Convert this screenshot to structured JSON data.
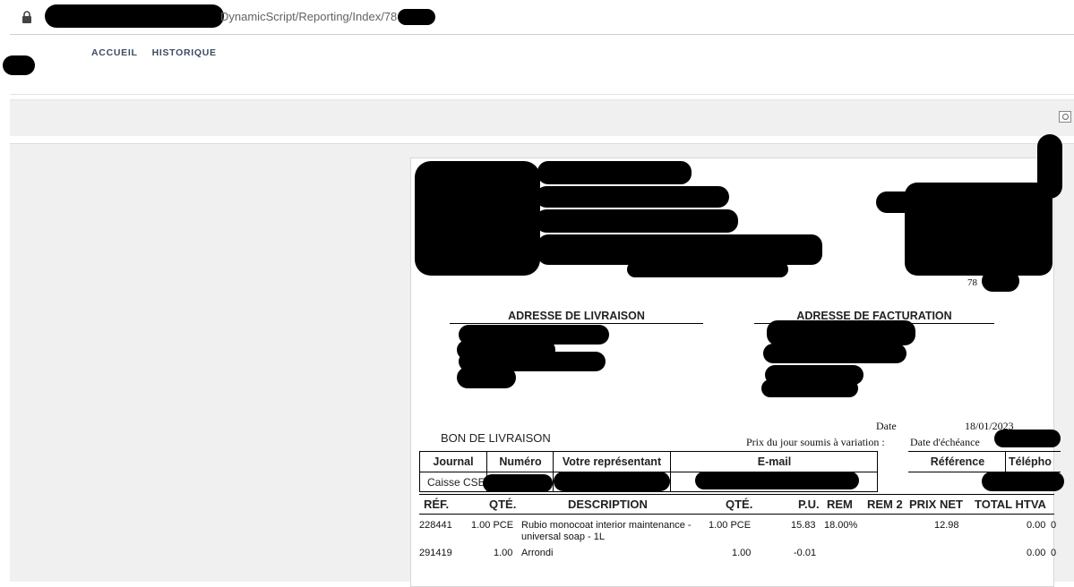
{
  "browser": {
    "url_visible": "DynamicScript/Reporting/Index/78"
  },
  "nav": {
    "items": [
      {
        "label": "ACCUEIL"
      },
      {
        "label": "HISTORIQUE"
      }
    ]
  },
  "report": {
    "addresses": {
      "delivery_title": "ADRESSE DE LIVRAISON",
      "billing_title": "ADRESSE DE FACTURATION"
    },
    "company_fragment": "78",
    "doc_title": "BON DE LIVRAISON",
    "price_note": "Prix du jour soumis à variation :",
    "date_label": "Date",
    "date_value": "18/01/2023",
    "due_label": "Date d'échéance",
    "info_headers": {
      "journal": "Journal",
      "numero": "Numéro",
      "representant": "Votre représentant",
      "email": "E-mail",
      "reference": "Référence",
      "telephone": "Télépho"
    },
    "info_values": {
      "journal": "Caisse CSE"
    },
    "columns": {
      "ref": "RÉF.",
      "qte": "QTÉ.",
      "description": "DESCRIPTION",
      "qte2": "QTÉ.",
      "pu": "P.U.",
      "rem": "REM",
      "rem2": "REM 2",
      "prix_net": "PRIX NET",
      "total_htva": "TOTAL HTVA"
    },
    "rows": [
      {
        "ref": "228441",
        "qte": "1.00 PCE",
        "description_line1": "Rubio monocoat interior maintenance -",
        "description_line2": "universal soap - 1L",
        "qte2": "1.00 PCE",
        "pu": "15.83",
        "rem": "18.00%",
        "prix_net": "12.98",
        "total": "0.00",
        "trail": "0"
      },
      {
        "ref": "291419",
        "qte": "1.00",
        "description_line1": "Arrondi",
        "qte2": "1.00",
        "pu": "-0.01",
        "total": "0.00",
        "trail": "0"
      }
    ]
  }
}
